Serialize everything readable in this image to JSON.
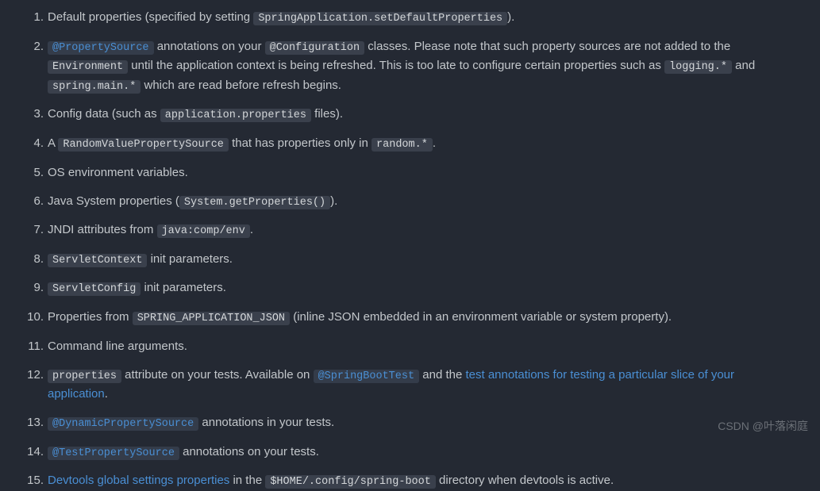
{
  "items": [
    {
      "parts": [
        {
          "type": "text",
          "val": "Default properties (specified by setting "
        },
        {
          "type": "code",
          "val": "SpringApplication.setDefaultProperties"
        },
        {
          "type": "text",
          "val": ")."
        }
      ]
    },
    {
      "parts": [
        {
          "type": "linkcode",
          "val": "@PropertySource"
        },
        {
          "type": "text",
          "val": " annotations on your "
        },
        {
          "type": "code",
          "val": "@Configuration"
        },
        {
          "type": "text",
          "val": " classes. Please note that such property sources are not added to the "
        },
        {
          "type": "code",
          "val": "Environment"
        },
        {
          "type": "text",
          "val": " until the application context is being refreshed. This is too late to configure certain properties such as "
        },
        {
          "type": "code",
          "val": "logging.*"
        },
        {
          "type": "text",
          "val": " and "
        },
        {
          "type": "code",
          "val": "spring.main.*"
        },
        {
          "type": "text",
          "val": " which are read before refresh begins."
        }
      ]
    },
    {
      "parts": [
        {
          "type": "text",
          "val": "Config data (such as "
        },
        {
          "type": "code",
          "val": "application.properties"
        },
        {
          "type": "text",
          "val": " files)."
        }
      ]
    },
    {
      "parts": [
        {
          "type": "text",
          "val": "A "
        },
        {
          "type": "code",
          "val": "RandomValuePropertySource"
        },
        {
          "type": "text",
          "val": " that has properties only in "
        },
        {
          "type": "code",
          "val": "random.*"
        },
        {
          "type": "text",
          "val": "."
        }
      ]
    },
    {
      "parts": [
        {
          "type": "text",
          "val": "OS environment variables."
        }
      ]
    },
    {
      "parts": [
        {
          "type": "text",
          "val": "Java System properties ("
        },
        {
          "type": "code",
          "val": "System.getProperties()"
        },
        {
          "type": "text",
          "val": ")."
        }
      ]
    },
    {
      "parts": [
        {
          "type": "text",
          "val": "JNDI attributes from "
        },
        {
          "type": "code",
          "val": "java:comp/env"
        },
        {
          "type": "text",
          "val": "."
        }
      ]
    },
    {
      "parts": [
        {
          "type": "code",
          "val": "ServletContext"
        },
        {
          "type": "text",
          "val": " init parameters."
        }
      ]
    },
    {
      "parts": [
        {
          "type": "code",
          "val": "ServletConfig"
        },
        {
          "type": "text",
          "val": " init parameters."
        }
      ]
    },
    {
      "parts": [
        {
          "type": "text",
          "val": "Properties from "
        },
        {
          "type": "code",
          "val": "SPRING_APPLICATION_JSON"
        },
        {
          "type": "text",
          "val": " (inline JSON embedded in an environment variable or system property)."
        }
      ]
    },
    {
      "parts": [
        {
          "type": "text",
          "val": "Command line arguments."
        }
      ]
    },
    {
      "parts": [
        {
          "type": "code",
          "val": "properties"
        },
        {
          "type": "text",
          "val": " attribute on your tests. Available on "
        },
        {
          "type": "linkcode",
          "val": "@SpringBootTest"
        },
        {
          "type": "text",
          "val": " and the "
        },
        {
          "type": "link",
          "val": "test annotations for testing a particular slice of your application"
        },
        {
          "type": "text",
          "val": "."
        }
      ]
    },
    {
      "parts": [
        {
          "type": "linkcode",
          "val": "@DynamicPropertySource"
        },
        {
          "type": "text",
          "val": " annotations in your tests."
        }
      ]
    },
    {
      "parts": [
        {
          "type": "linkcode",
          "val": "@TestPropertySource"
        },
        {
          "type": "text",
          "val": " annotations on your tests."
        }
      ]
    },
    {
      "parts": [
        {
          "type": "link",
          "val": "Devtools global settings properties"
        },
        {
          "type": "text",
          "val": " in the "
        },
        {
          "type": "code",
          "val": "$HOME/.config/spring-boot"
        },
        {
          "type": "text",
          "val": " directory when devtools is active."
        }
      ]
    }
  ],
  "watermark": "CSDN @叶落闲庭"
}
